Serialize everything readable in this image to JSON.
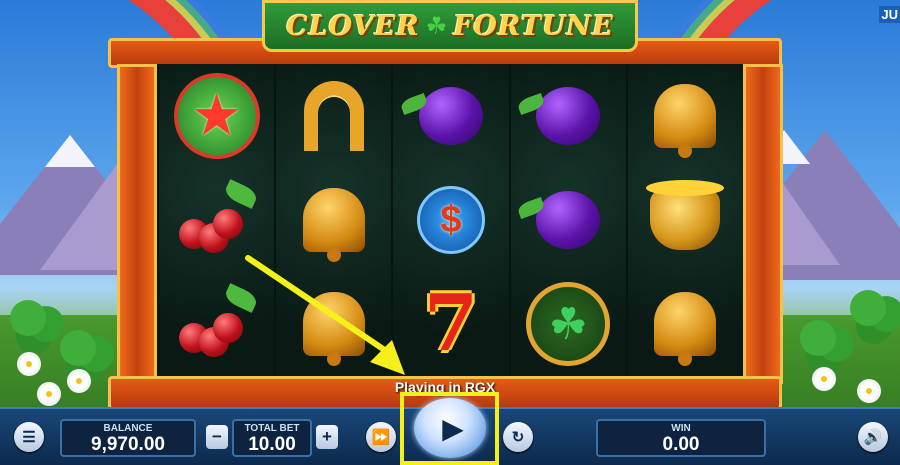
{
  "game": {
    "title_left": "CLOVER",
    "title_right": "FORTUNE",
    "corner_text": "JU",
    "banner": "Playing in RGX"
  },
  "reels": [
    [
      "star",
      "cherries",
      "cherries"
    ],
    [
      "horseshoe",
      "bell",
      "bell"
    ],
    [
      "plum",
      "money-bag",
      "seven"
    ],
    [
      "plum",
      "plum",
      "clover-coin"
    ],
    [
      "bell",
      "pot-of-gold",
      "bell"
    ]
  ],
  "controls": {
    "menu_icon": "menu-icon",
    "balance_label": "BALANCE",
    "balance_value": "9,970.00",
    "minus_label": "−",
    "total_bet_label": "TOTAL BET",
    "total_bet_value": "10.00",
    "plus_label": "+",
    "fast_forward_icon": "fast-forward-icon",
    "spin_icon": "play-icon",
    "autoplay_icon": "autoplay-icon",
    "win_label": "WIN",
    "win_value": "0.00",
    "sound_icon": "speaker-icon"
  },
  "colors": {
    "highlight": "#f4f01c",
    "bar": "#0c2a4d"
  }
}
